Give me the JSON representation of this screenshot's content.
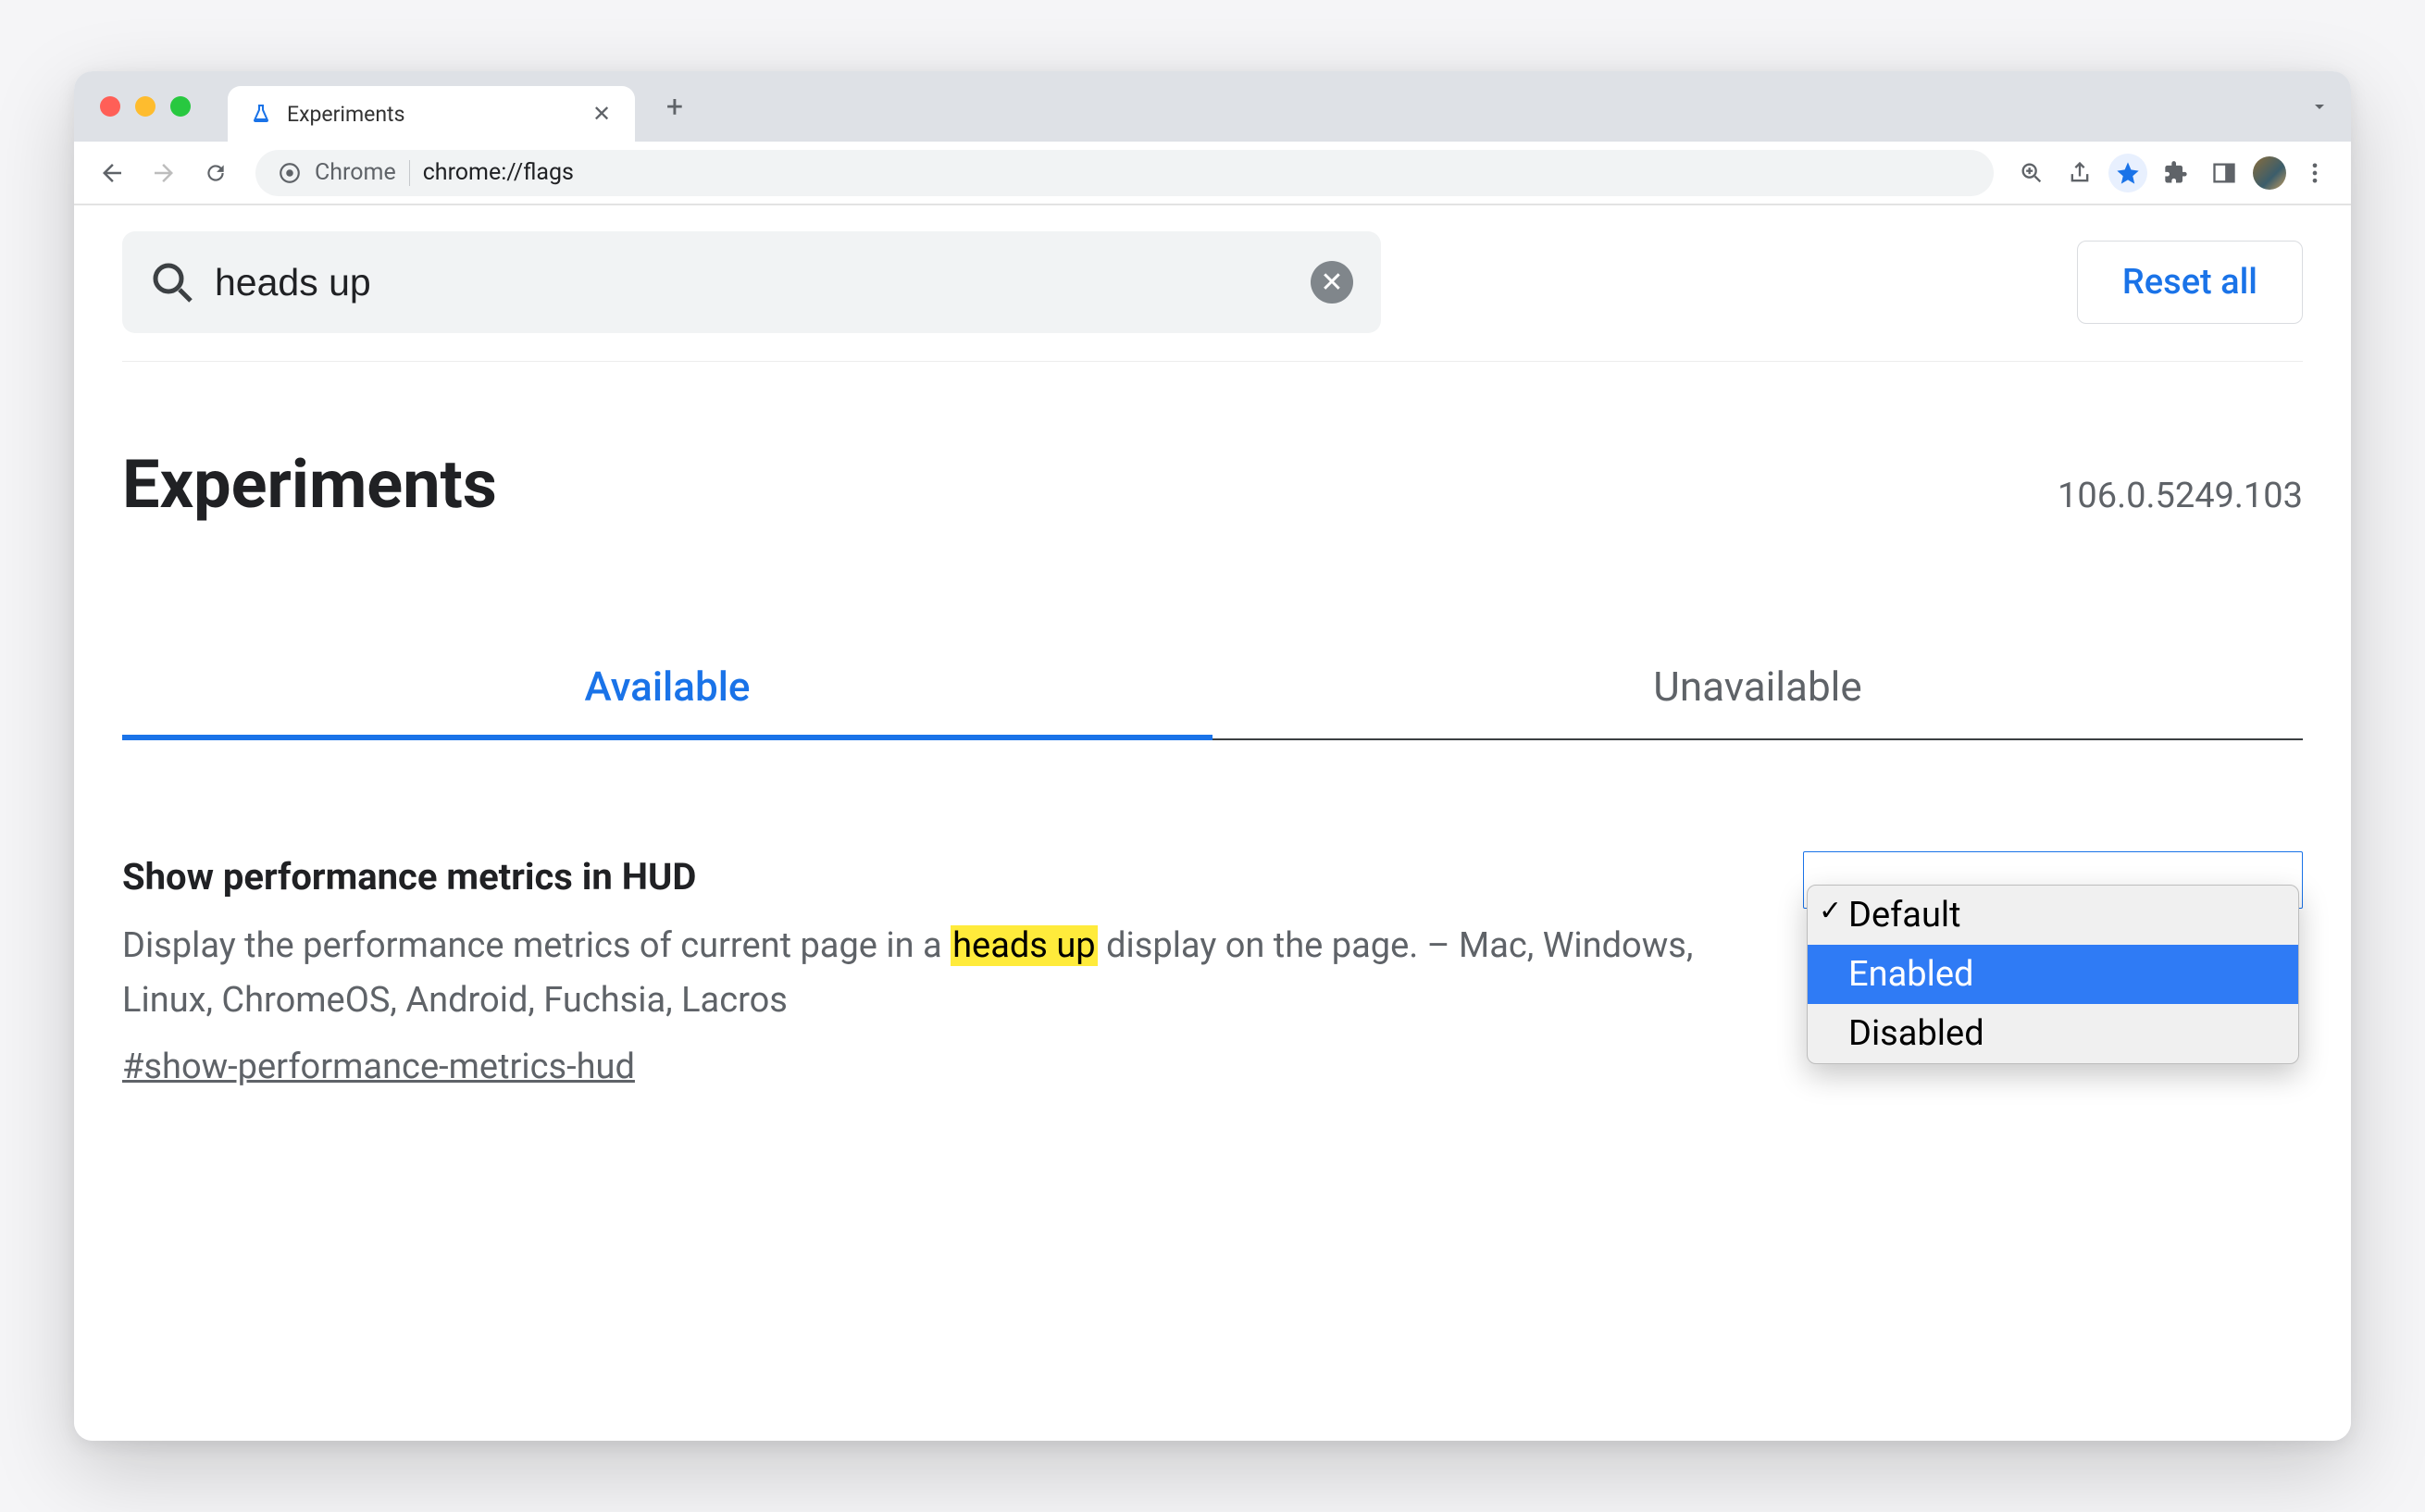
{
  "tab": {
    "title": "Experiments"
  },
  "address_bar": {
    "prefix": "Chrome",
    "path": "chrome://flags"
  },
  "search": {
    "value": "heads up"
  },
  "reset_label": "Reset all",
  "page_title": "Experiments",
  "version": "106.0.5249.103",
  "tabs": {
    "available": "Available",
    "unavailable": "Unavailable"
  },
  "flag": {
    "title": "Show performance metrics in HUD",
    "desc_pre": "Display the performance metrics of current page in a ",
    "desc_hl": "heads up",
    "desc_post": " display on the page. – Mac, Windows, Linux, ChromeOS, Android, Fuchsia, Lacros",
    "anchor": "#show-performance-metrics-hud"
  },
  "dropdown": {
    "options": {
      "default": "Default",
      "enabled": "Enabled",
      "disabled": "Disabled"
    }
  }
}
